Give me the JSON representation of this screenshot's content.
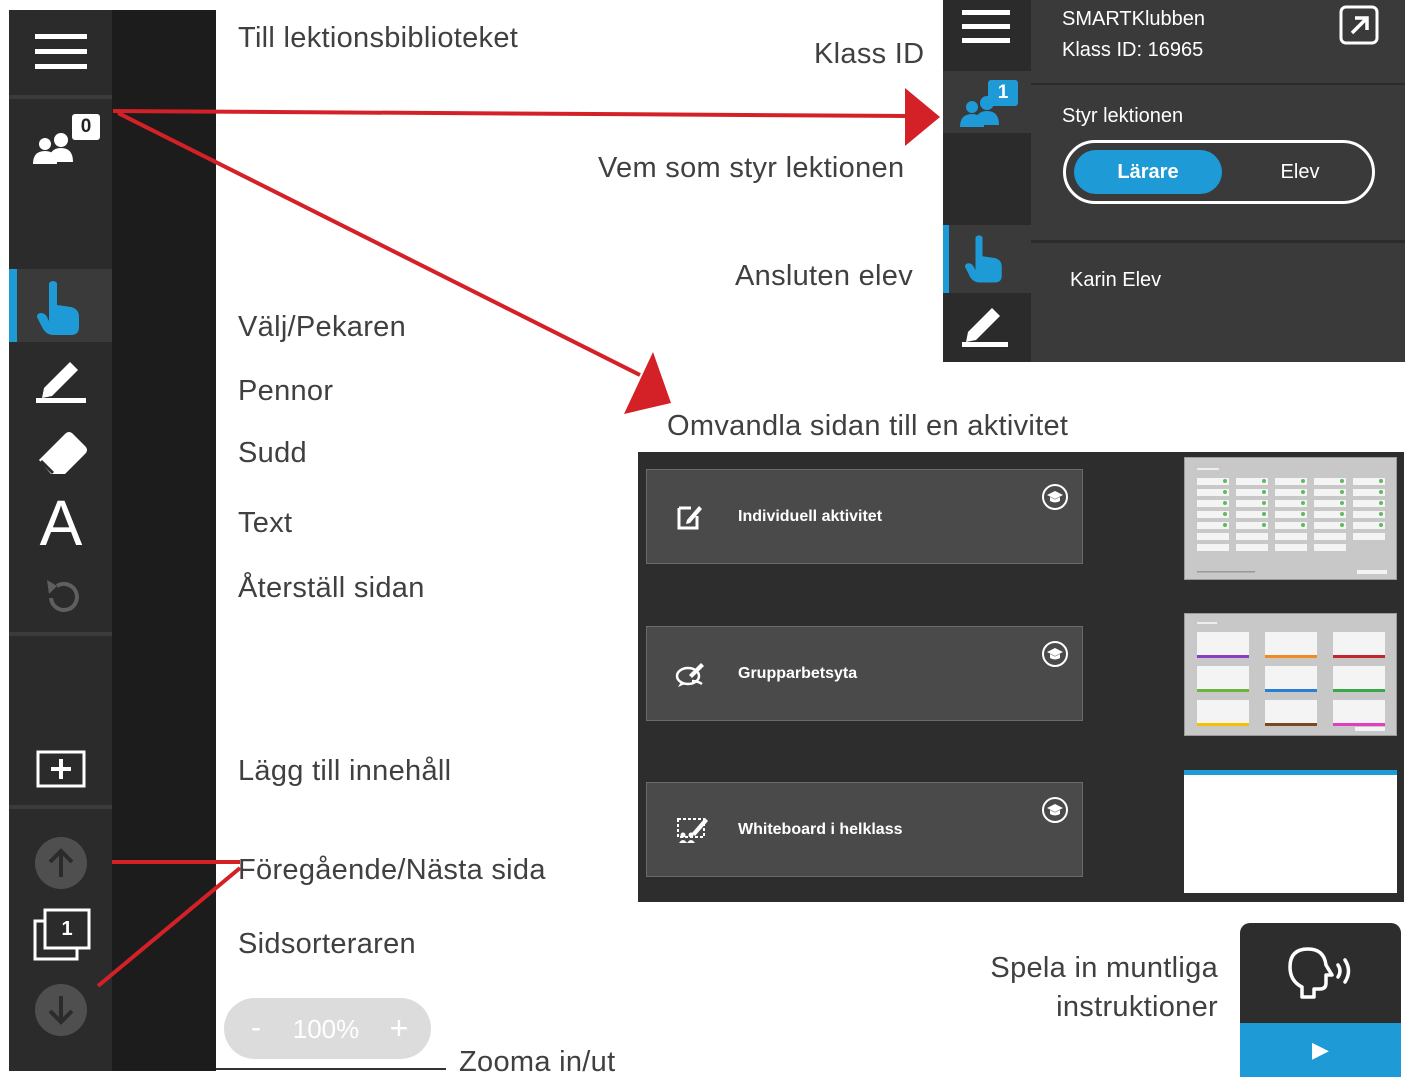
{
  "annotations": {
    "library": "Till lektionsbiblioteket",
    "class_id": "Klass ID",
    "who_controls": "Vem som styr lektionen",
    "connected_student": "Ansluten elev",
    "select": "Välj/Pekaren",
    "pens": "Pennor",
    "eraser": "Sudd",
    "text": "Text",
    "reset": "Återställ sidan",
    "add_content": "Lägg till innehåll",
    "prev_next": "Föregående/Nästa sida",
    "page_sorter": "Sidsorteraren",
    "zoom": "Zooma in/ut",
    "convert": "Omvandla sidan till en aktivitet",
    "record_line1": "Spela in muntliga",
    "record_line2": "instruktioner"
  },
  "toolbar": {
    "participants_count": "0",
    "text_tool_glyph": "A",
    "page_number": "1",
    "icons": [
      "menu-icon",
      "participants-icon",
      "pointer-hand-icon",
      "pen-icon",
      "eraser-icon",
      "text-icon",
      "undo-reset-icon",
      "add-content-icon",
      "arrow-up-icon",
      "page-sorter-icon",
      "arrow-down-icon"
    ]
  },
  "zoom": {
    "minus": "-",
    "level": "100%",
    "plus": "+"
  },
  "class_panel": {
    "class_name": "SMARTKlubben",
    "class_id": "Klass ID: 16965",
    "participants_count": "1",
    "control_heading": "Styr lektionen",
    "toggle_options": [
      "Lärare",
      "Elev"
    ],
    "selected_option": "Lärare",
    "student_name": "Karin Elev"
  },
  "activities": [
    {
      "label": "Individuell aktivitet",
      "icon": "edit-note-icon"
    },
    {
      "label": "Grupparbetsyta",
      "icon": "group-chat-icon"
    },
    {
      "label": "Whiteboard i helklass",
      "icon": "whiteboard-class-icon"
    }
  ],
  "record": {
    "play_glyph": "▶"
  },
  "colors": {
    "accent_blue": "#1e9ad6",
    "toolbar": "#2b2b2b",
    "arrow_red": "#d42027"
  }
}
